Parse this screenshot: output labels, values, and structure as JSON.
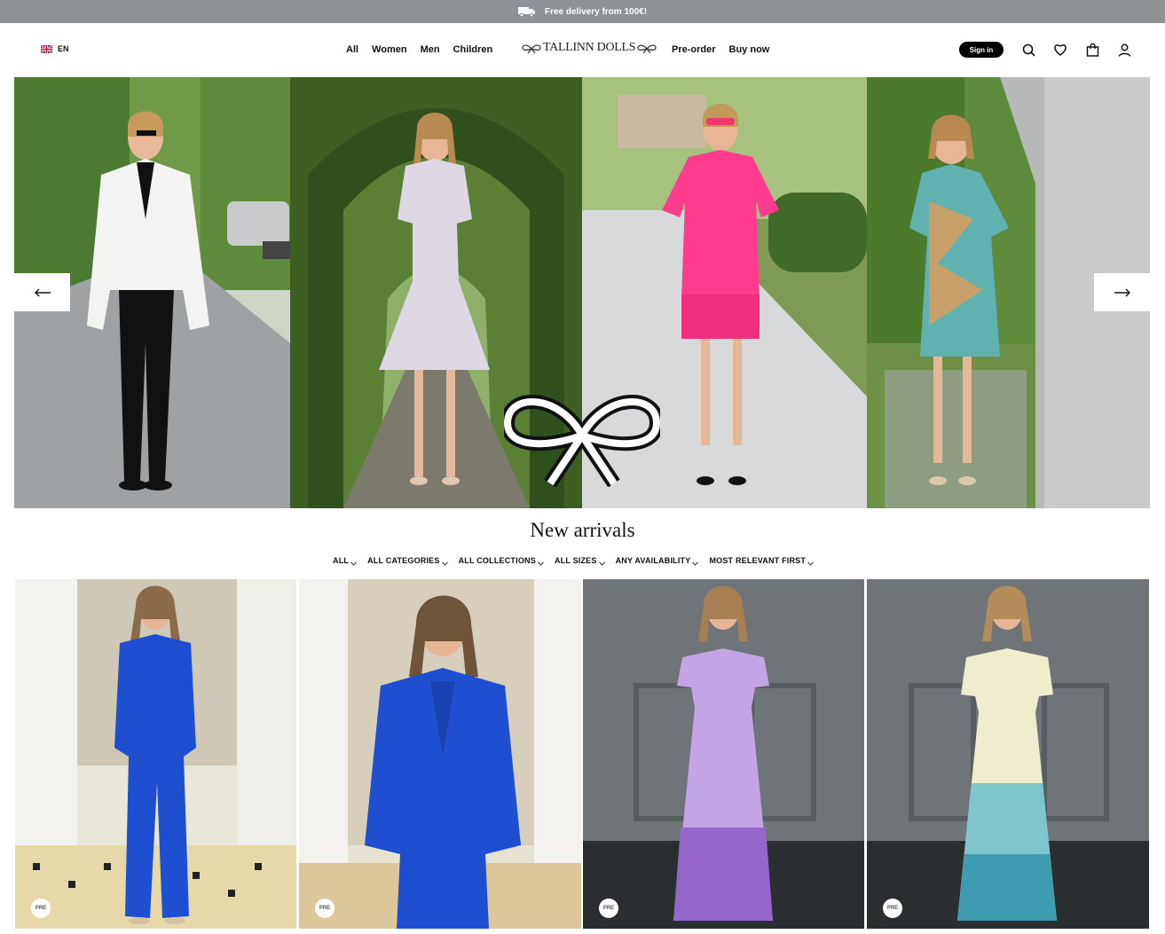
{
  "promo": {
    "text": "Free delivery from 100€!",
    "icon": "truck-icon"
  },
  "header": {
    "language": {
      "code": "EN",
      "icon": "uk-flag-icon"
    },
    "nav_left": [
      "All",
      "Women",
      "Men",
      "Children"
    ],
    "logo_text": "TALLINN DOLLS",
    "nav_right": [
      "Pre-order",
      "Buy now"
    ],
    "sign_in": "Sign in",
    "icons": [
      "search-icon",
      "heart-icon",
      "cart-icon",
      "user-icon"
    ]
  },
  "hero": {
    "prev_icon": "arrow-left-icon",
    "next_icon": "arrow-right-icon",
    "slides": [
      "white tuxedo blazer outfit",
      "lilac dress",
      "pink fringe dress",
      "sequin print dress"
    ]
  },
  "new_arrivals": {
    "title": "New arrivals",
    "filters": [
      "ALL",
      "ALL CATEGORIES",
      "ALL COLLECTIONS",
      "ALL SIZES",
      "ANY AVAILABILITY",
      "MOST RELEVANT FIRST"
    ],
    "products": [
      {
        "badge": "PRE",
        "color": "#1f4fd1"
      },
      {
        "badge": "PRE",
        "color": "#1f4fd1"
      },
      {
        "badge": "PRE",
        "color": "#b48ad8"
      },
      {
        "badge": "PRE",
        "color": "#53b1bd"
      }
    ]
  },
  "colors": {
    "promo_bg": "#8e9196",
    "button_bg": "#000000",
    "text": "#111111"
  }
}
